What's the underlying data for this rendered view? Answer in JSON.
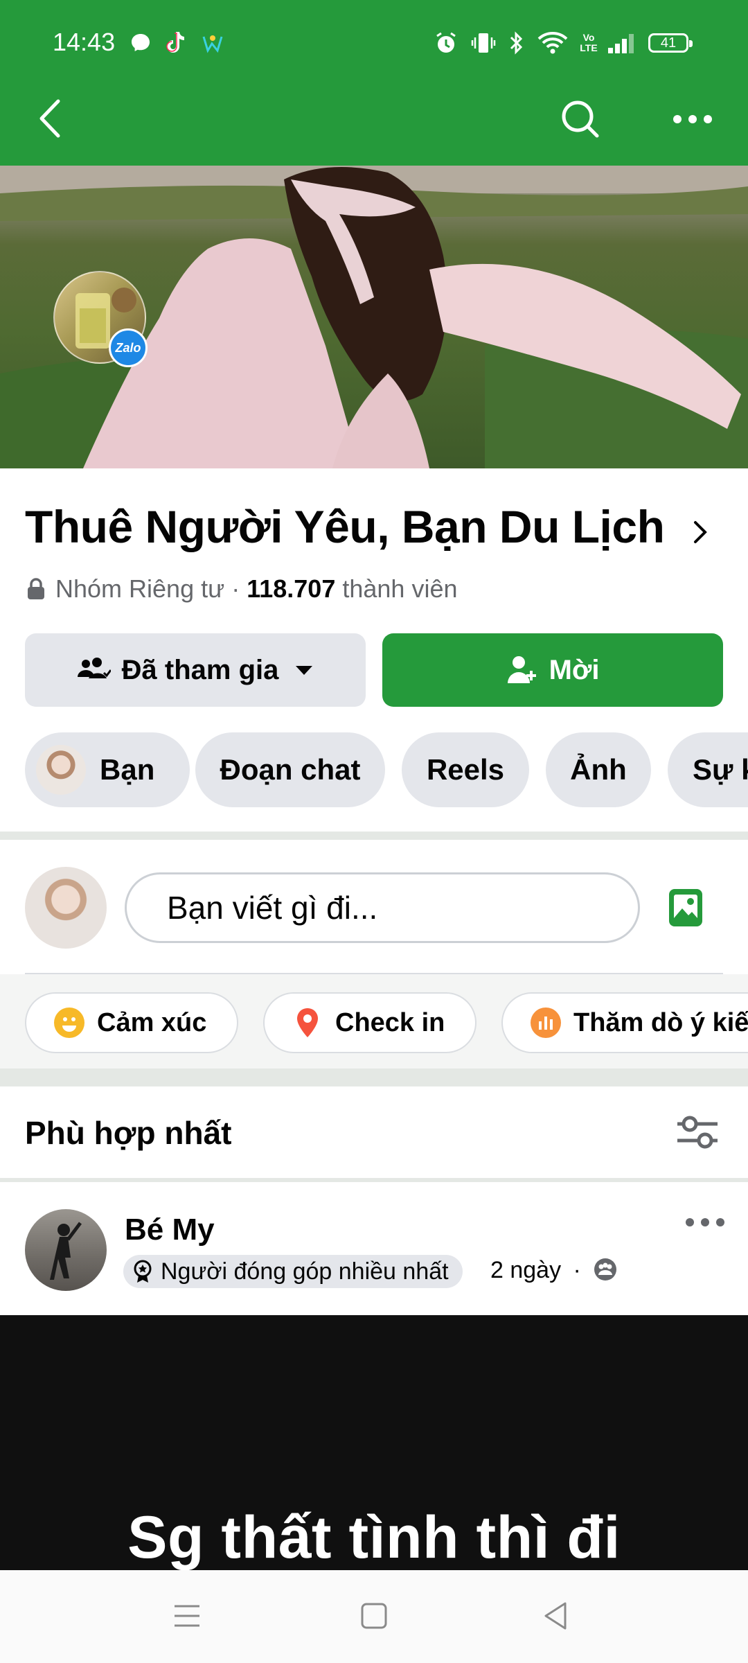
{
  "status_bar": {
    "time": "14:43",
    "network": "Vo LTE",
    "battery": "41"
  },
  "toolbar": {
    "back_icon": "back-arrow-icon",
    "search_icon": "search-icon",
    "more_icon": "more-dots-icon"
  },
  "cover": {
    "badge_text": "Zalo"
  },
  "group": {
    "title": "Thuê Người Yêu, Bạn Du Lịch",
    "privacy": "Nhóm Riêng tư",
    "separator": "·",
    "member_count": "118.707",
    "member_label": "thành viên"
  },
  "actions": {
    "joined_label": "Đã tham gia",
    "invite_label": "Mời"
  },
  "tabs": [
    {
      "label": "Bạn"
    },
    {
      "label": "Đoạn chat"
    },
    {
      "label": "Reels"
    },
    {
      "label": "Ảnh"
    },
    {
      "label": "Sự kiện"
    }
  ],
  "composer": {
    "placeholder": "Bạn viết gì đi...",
    "chips": [
      {
        "label": "Cảm xúc",
        "color": "#f7b928"
      },
      {
        "label": "Check in",
        "color": "#f5533d"
      },
      {
        "label": "Thăm dò ý kiến",
        "color": "#f7923b"
      }
    ]
  },
  "sort": {
    "label": "Phù hợp nhất"
  },
  "post": {
    "author": "Bé My",
    "badge": "Người đóng góp nhiều nhất",
    "time": "2 ngày",
    "separator": "·",
    "caption": "Sg thất tình thì đi"
  },
  "colors": {
    "brand_green": "#259a3b",
    "chip_gray": "#e4e6eb"
  }
}
